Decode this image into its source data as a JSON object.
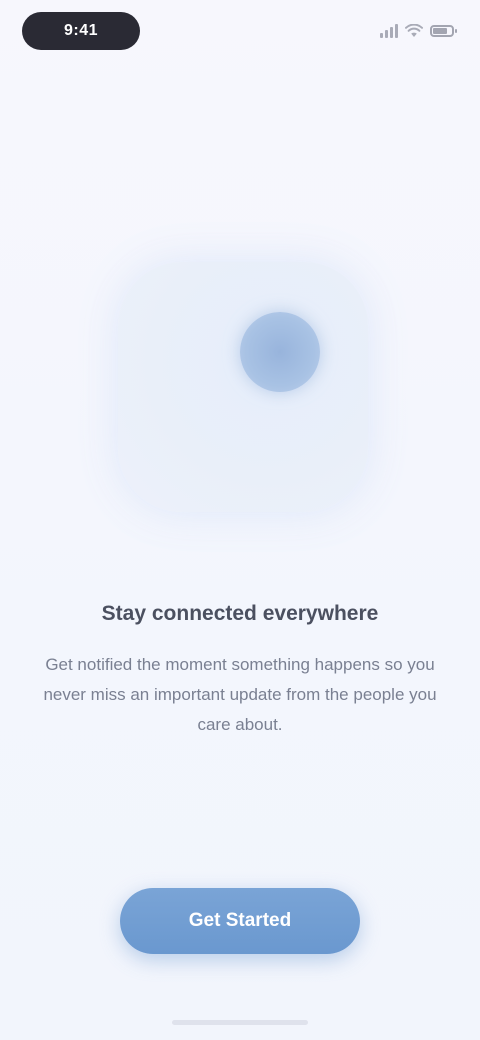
{
  "status_bar": {
    "time": "9:41",
    "signal_icon": "cellular-signal-icon",
    "wifi_icon": "wifi-icon",
    "battery_icon": "battery-icon",
    "battery_level": 0.8
  },
  "illustration": {
    "icon": "illustration-dot"
  },
  "content": {
    "title": "Stay connected everywhere",
    "body": "Get notified the moment something happens so you never miss an important update from the people you care about."
  },
  "actions": {
    "primary_label": "Get Started"
  },
  "colors": {
    "background": "#f5f6fd",
    "accent": "#6f9cd2",
    "illustration_bg": "#e8eef9",
    "illustration_dot": "#9db7de",
    "status_pill": "#2a2a34"
  }
}
